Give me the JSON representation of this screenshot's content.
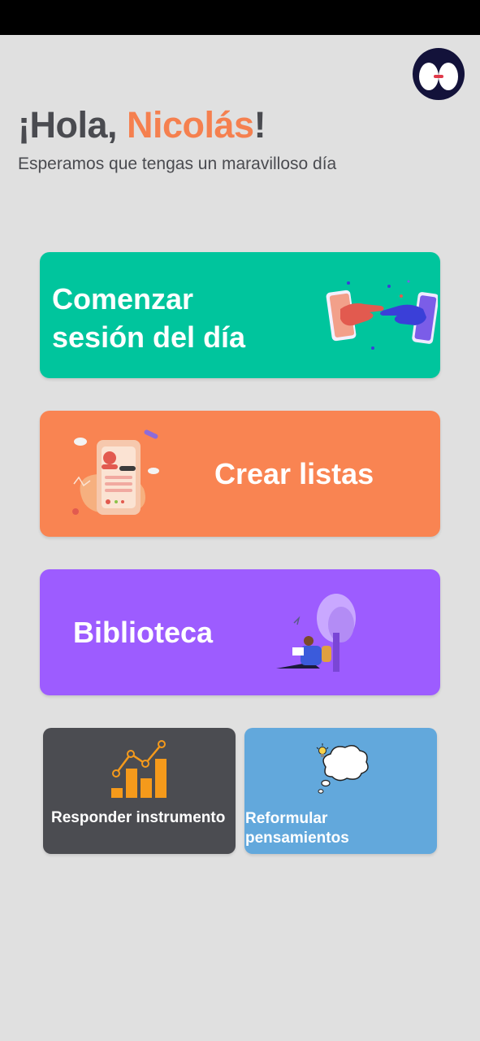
{
  "greeting": {
    "prefix": "¡Hola, ",
    "name": "Nicolás",
    "suffix": "!",
    "subtitle": "Esperamos que tengas un maravilloso día"
  },
  "cards": {
    "session": {
      "line1": "Comenzar",
      "line2": "sesión del día",
      "icon": "hands-phones-illustration",
      "color": "#00c59d"
    },
    "lists": {
      "label": "Crear listas",
      "icon": "phone-profile-illustration",
      "color": "#f98452"
    },
    "library": {
      "label": "Biblioteca",
      "icon": "reading-under-tree-illustration",
      "color": "#9d5cff"
    },
    "instrument": {
      "label": "Responder instrumento",
      "icon": "bar-chart-icon",
      "color": "#4b4c51"
    },
    "reframe": {
      "line1": "Reformular",
      "line2": "pensamientos",
      "icon": "thought-cloud-icon",
      "color": "#62a8dc"
    }
  },
  "colors": {
    "accent": "#f5804f",
    "text": "#4a4b50",
    "background": "#e0e0e0",
    "avatar_bg": "#13123a"
  }
}
